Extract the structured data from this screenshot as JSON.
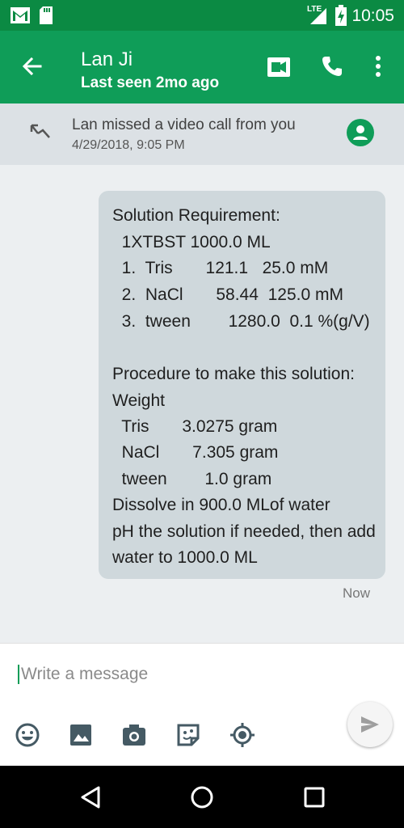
{
  "status_bar": {
    "network": "LTE",
    "time": "10:05"
  },
  "header": {
    "contact_name": "Lan Ji",
    "last_seen": "Last seen 2mo ago"
  },
  "missed_call": {
    "text": "Lan missed a video call from you",
    "timestamp": "4/29/2018, 9:05 PM"
  },
  "message": {
    "lines": [
      "Solution Requirement:",
      "  1XTBST 1000.0 ML",
      "  1.  Tris       121.1   25.0 mM",
      "  2.  NaCl       58.44  125.0 mM",
      "  3.  tween        1280.0  0.1 %(g/V)",
      "",
      "Procedure to make this solution:",
      "Weight",
      "  Tris       3.0275 gram",
      "  NaCl       7.305 gram",
      "  tween        1.0 gram",
      "Dissolve in 900.0 MLof water",
      "pH the solution if needed, then add",
      "water to 1000.0 ML"
    ],
    "time": "Now"
  },
  "composer": {
    "placeholder": "Write a message"
  },
  "icons": {
    "status_left": [
      "gmail-icon",
      "sd-card-icon"
    ],
    "status_right": [
      "lte-signal-icon",
      "battery-charging-icon"
    ],
    "header": [
      "back-arrow-icon",
      "video-call-icon",
      "phone-icon",
      "more-vert-icon"
    ],
    "banner": [
      "missed-video-call-icon",
      "contact-avatar-icon"
    ],
    "composer": [
      "emoji-icon",
      "image-icon",
      "camera-icon",
      "sticker-icon",
      "location-icon",
      "send-icon"
    ],
    "nav": [
      "nav-back-icon",
      "nav-home-icon",
      "nav-recents-icon"
    ]
  },
  "colors": {
    "status_bar": "#0b8a43",
    "toolbar": "#0f9d58",
    "banner": "#dce1e5",
    "bubble": "#cfd8dc",
    "background": "#eceff1"
  }
}
